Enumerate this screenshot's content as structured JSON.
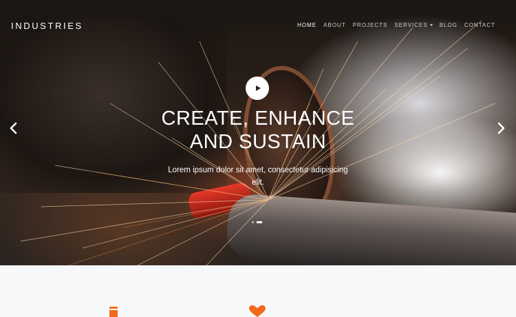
{
  "brand": "INDUSTRIES",
  "nav": {
    "items": [
      {
        "label": "HOME",
        "active": true
      },
      {
        "label": "ABOUT"
      },
      {
        "label": "PROJECTS"
      },
      {
        "label": "SERVICES",
        "dropdown": true
      },
      {
        "label": "BLOG"
      },
      {
        "label": "CONTACT"
      }
    ]
  },
  "hero": {
    "headline_line1": "CREATE, ENHANCE",
    "headline_line2": "AND SUSTAIN",
    "subtext": "Lorem ipsum dolor sit amet, consectetur adipisicing elit.",
    "play_icon": "play-icon",
    "prev_icon": "chevron-left-icon",
    "next_icon": "chevron-right-icon",
    "slides_count": 2,
    "active_slide": 2
  },
  "features": {
    "icons": [
      "document-icon",
      "heart-icon"
    ],
    "accent": "#f26a1b"
  },
  "colors": {
    "text_on_hero": "#ffffff",
    "section_bg": "#f7f8fa"
  }
}
